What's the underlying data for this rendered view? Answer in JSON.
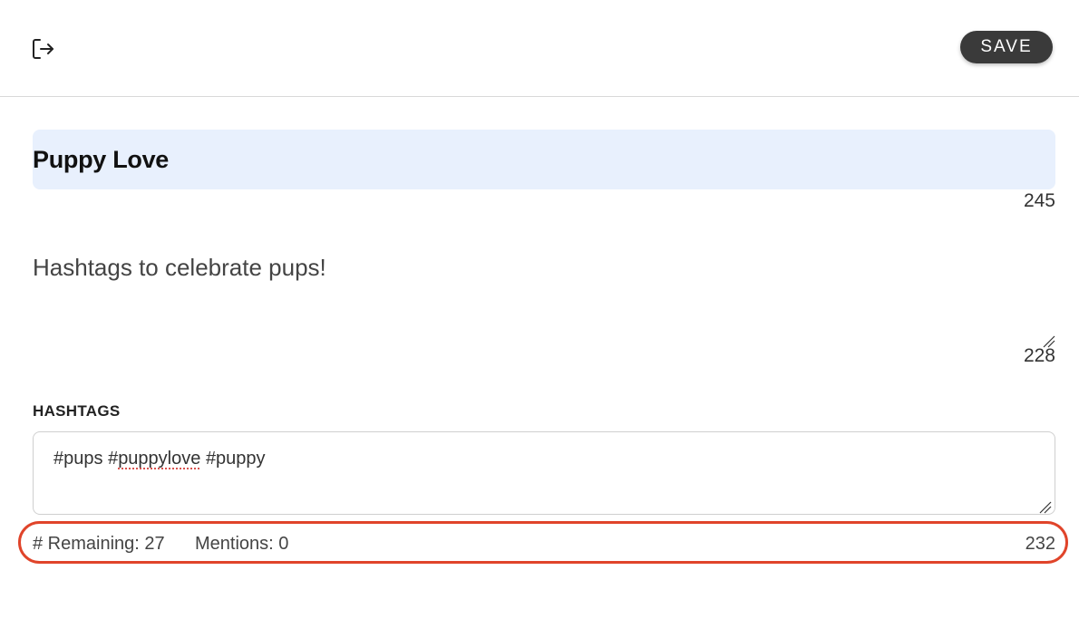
{
  "toolbar": {
    "logout_icon": "logout-icon",
    "save_label": "SAVE"
  },
  "title": {
    "value": "Puppy Love",
    "remaining": "245"
  },
  "description": {
    "value": "Hashtags to celebrate pups!",
    "remaining": "228"
  },
  "hashtags": {
    "label": "HASHTAGS",
    "tags": [
      "#pups",
      "#puppylove",
      "#puppy"
    ],
    "remaining_label": "# Remaining: 27",
    "mentions_label": "Mentions: 0",
    "char_remaining": "232"
  },
  "colors": {
    "save_bg": "#3a3a3a",
    "title_bg": "#e8f0fd",
    "highlight": "#e0442a"
  }
}
